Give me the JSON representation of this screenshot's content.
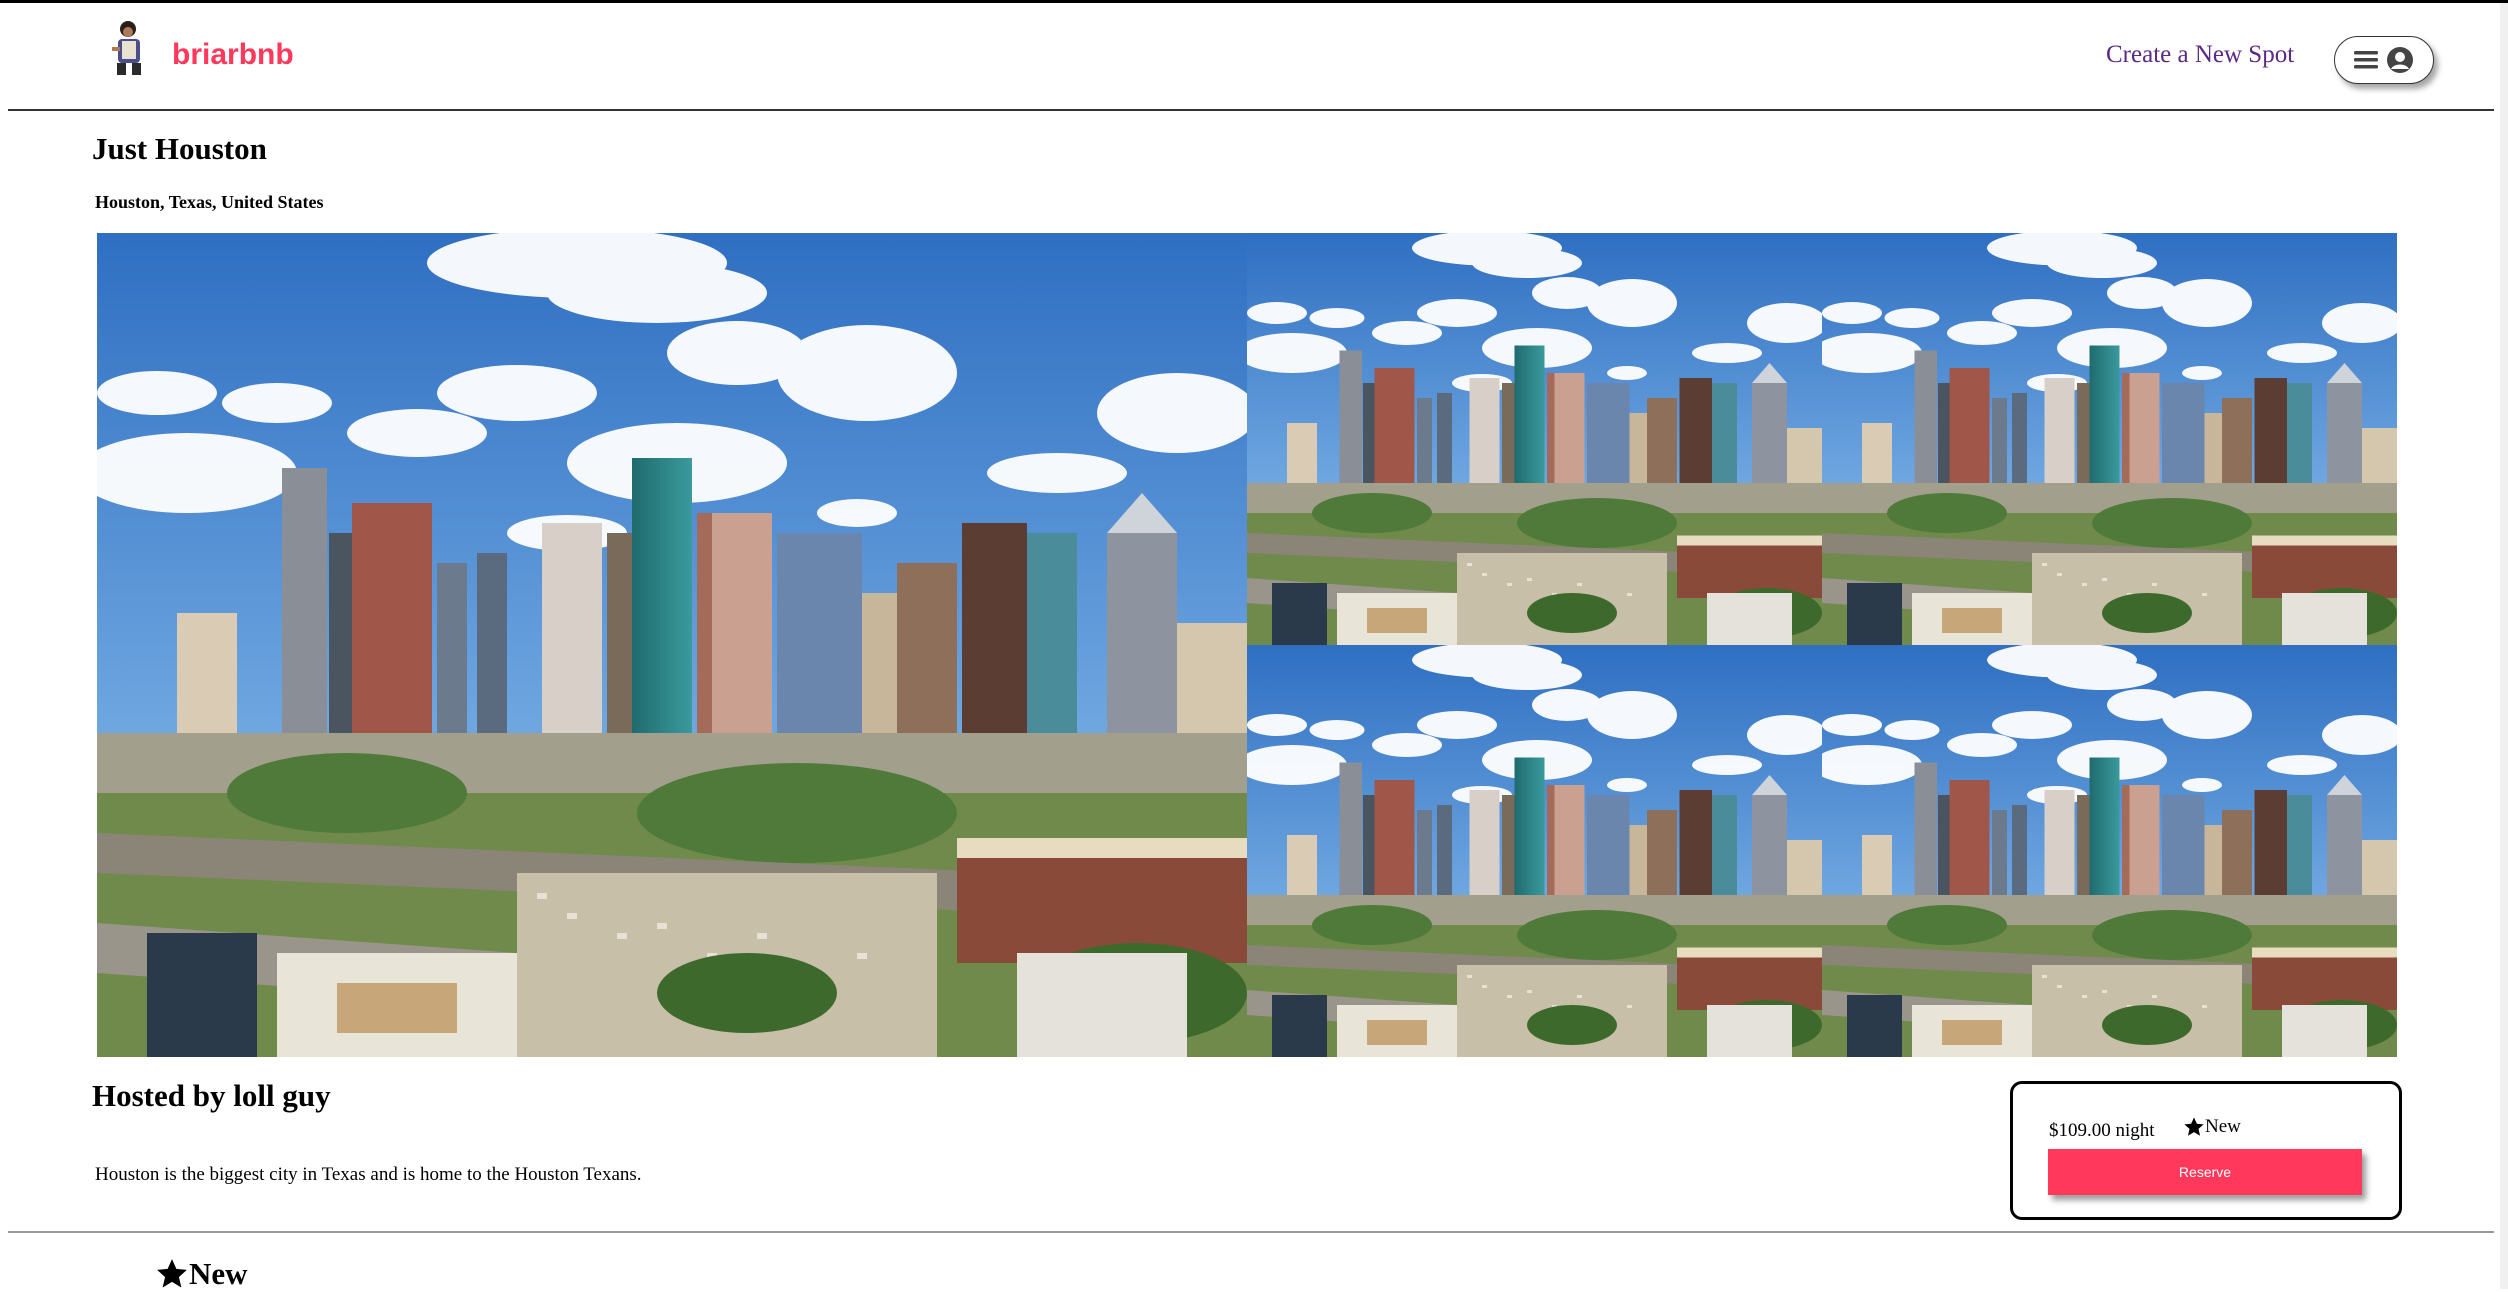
{
  "brand": {
    "name": "briarbnb",
    "color": "#ff385c",
    "logo_icon": "avatar-logo-icon"
  },
  "header": {
    "create_spot_label": "Create a New Spot",
    "menu_icon": "hamburger-icon",
    "profile_icon": "user-circle-icon"
  },
  "spot": {
    "name": "Just Houston",
    "location": "Houston, Texas, United States",
    "images": [
      {
        "alt": "Houston skyline aerial"
      },
      {
        "alt": "Houston skyline aerial"
      },
      {
        "alt": "Houston skyline aerial"
      },
      {
        "alt": "Houston skyline aerial"
      },
      {
        "alt": "Houston skyline aerial"
      }
    ],
    "hosted_by": "Hosted by loll guy",
    "description": "Houston is the biggest city in Texas and is home to the Houston Texans."
  },
  "booking": {
    "price": "$109.00 night",
    "rating_label": "New",
    "rating_icon": "star-icon",
    "reserve_label": "Reserve",
    "button_color": "#ff385c"
  },
  "reviews": {
    "rating_label": "New",
    "rating_icon": "star-icon"
  }
}
